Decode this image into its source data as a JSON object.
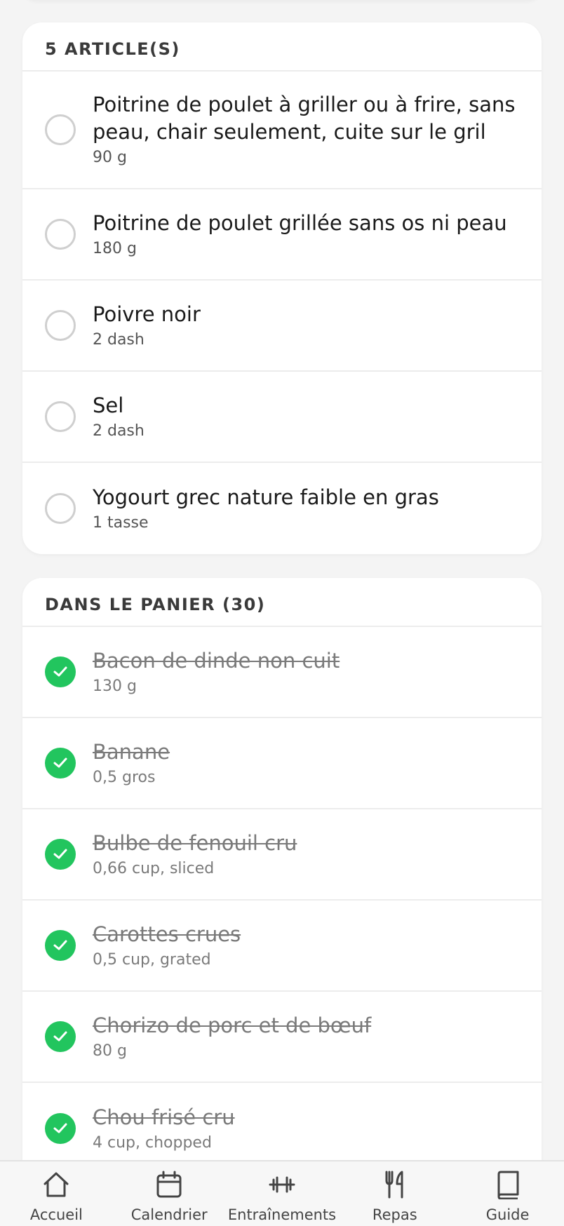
{
  "todo_section": {
    "title": "5 ARTICLE(S)",
    "items": [
      {
        "name": "Poitrine de poulet à griller ou à frire, sans peau, chair seulement, cuite sur le gril",
        "qty": "90 g"
      },
      {
        "name": "Poitrine de poulet grillée sans os ni peau",
        "qty": "180 g"
      },
      {
        "name": "Poivre noir",
        "qty": "2 dash"
      },
      {
        "name": "Sel",
        "qty": "2 dash"
      },
      {
        "name": "Yogourt grec nature faible en gras",
        "qty": "1 tasse"
      }
    ]
  },
  "cart_section": {
    "title": "DANS LE PANIER (30)",
    "items": [
      {
        "name": "Bacon de dinde non cuit",
        "qty": "130 g"
      },
      {
        "name": "Banane",
        "qty": "0,5 gros"
      },
      {
        "name": "Bulbe de fenouil cru",
        "qty": "0,66 cup, sliced"
      },
      {
        "name": "Carottes crues",
        "qty": "0,5 cup, grated"
      },
      {
        "name": "Chorizo de porc et de bœuf",
        "qty": "80 g"
      },
      {
        "name": "Chou frisé cru",
        "qty": "4 cup, chopped"
      }
    ]
  },
  "tabbar": {
    "tabs": [
      {
        "label": "Accueil",
        "icon": "home-icon"
      },
      {
        "label": "Calendrier",
        "icon": "calendar-icon"
      },
      {
        "label": "Entraînements",
        "icon": "dumbbell-icon"
      },
      {
        "label": "Repas",
        "icon": "utensils-icon"
      },
      {
        "label": "Guide",
        "icon": "book-icon"
      }
    ]
  },
  "colors": {
    "checked": "#22c55e",
    "unchecked_border": "#cfcfcf",
    "background": "#f4f4f4"
  }
}
